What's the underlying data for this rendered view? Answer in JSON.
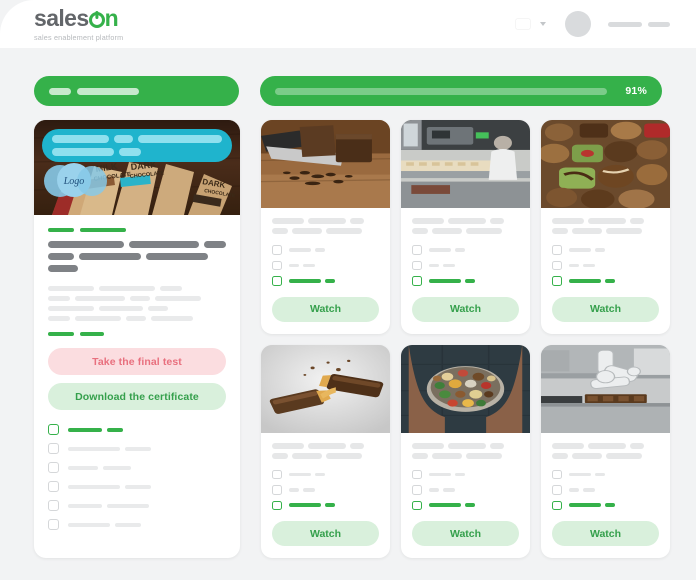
{
  "brand": {
    "name_part1": "sales",
    "name_part2": "n",
    "tagline": "sales enablement platform",
    "accent_green": "#35b14a",
    "logo_grey": "#63666a"
  },
  "topbar": {
    "language_flag": "poland-flag",
    "language_chevron": "chevron-down-icon",
    "avatar": "user-avatar",
    "user_name_placeholder": ""
  },
  "progress": {
    "course_bar": {
      "segments": [
        22,
        62
      ],
      "label": ""
    },
    "module_bar": {
      "percent_label": "91%",
      "percent_value": 91
    }
  },
  "lesson_panel": {
    "hero_image": "chocolate-bars-packaging-photo",
    "hero_banner_rows": [
      [
        58,
        20,
        86
      ],
      [
        62,
        22
      ]
    ],
    "title_dashes": [
      26,
      46
    ],
    "title_rows": [
      [
        76,
        70,
        22
      ],
      [
        26,
        62,
        62
      ],
      [
        30
      ]
    ],
    "body_rows": [
      [
        46,
        56,
        22
      ],
      [
        22,
        50,
        20,
        62
      ],
      [
        46,
        44,
        20
      ],
      [
        22,
        46,
        20,
        50
      ]
    ],
    "footer_dashes": [
      26,
      24
    ],
    "buttons": {
      "final_test": "Take the final test",
      "download_certificate": "Download the certificate"
    },
    "checklist": [
      {
        "active": true,
        "lines": [
          34,
          16
        ]
      },
      {
        "active": false,
        "lines": [
          52,
          26
        ]
      },
      {
        "active": false,
        "lines": [
          30,
          28
        ]
      },
      {
        "active": false,
        "lines": [
          52,
          26
        ]
      },
      {
        "active": false,
        "lines": [
          34,
          42
        ]
      },
      {
        "active": false,
        "lines": [
          42,
          26
        ]
      }
    ]
  },
  "cards": [
    {
      "image": "chopped-dark-chocolate-with-knife-photo",
      "text_rows": [
        [
          32,
          38,
          14
        ],
        [
          16,
          30,
          36
        ]
      ],
      "checklist": [
        {
          "active": false,
          "lines": [
            22,
            10
          ]
        },
        {
          "active": false,
          "lines": [
            10,
            12
          ]
        },
        {
          "active": true,
          "lines": [
            32,
            10
          ]
        }
      ],
      "watch_label": "Watch"
    },
    {
      "image": "chocolate-factory-production-line-photo",
      "text_rows": [
        [
          32,
          38,
          14
        ],
        [
          16,
          30,
          36
        ]
      ],
      "checklist": [
        {
          "active": false,
          "lines": [
            22,
            10
          ]
        },
        {
          "active": false,
          "lines": [
            10,
            12
          ]
        },
        {
          "active": true,
          "lines": [
            32,
            10
          ]
        }
      ],
      "watch_label": "Watch"
    },
    {
      "image": "assorted-chocolate-pralines-photo",
      "text_rows": [
        [
          32,
          38,
          14
        ],
        [
          16,
          30,
          36
        ]
      ],
      "checklist": [
        {
          "active": false,
          "lines": [
            22,
            10
          ]
        },
        {
          "active": false,
          "lines": [
            10,
            12
          ]
        },
        {
          "active": true,
          "lines": [
            32,
            10
          ]
        }
      ],
      "watch_label": "Watch"
    },
    {
      "image": "chocolate-bar-caramel-stretch-photo",
      "text_rows": [
        [
          32,
          38,
          14
        ],
        [
          16,
          30,
          36
        ]
      ],
      "checklist": [
        {
          "active": false,
          "lines": [
            22,
            10
          ]
        },
        {
          "active": false,
          "lines": [
            10,
            12
          ]
        },
        {
          "active": true,
          "lines": [
            32,
            10
          ]
        }
      ],
      "watch_label": "Watch"
    },
    {
      "image": "hands-holding-bowl-of-colorful-candy-photo",
      "text_rows": [
        [
          32,
          38,
          14
        ],
        [
          16,
          30,
          36
        ]
      ],
      "checklist": [
        {
          "active": false,
          "lines": [
            22,
            10
          ]
        },
        {
          "active": false,
          "lines": [
            10,
            12
          ]
        },
        {
          "active": true,
          "lines": [
            32,
            10
          ]
        }
      ],
      "watch_label": "Watch"
    },
    {
      "image": "robotic-arm-factory-photo",
      "text_rows": [
        [
          32,
          38,
          14
        ],
        [
          16,
          30,
          36
        ]
      ],
      "checklist": [
        {
          "active": false,
          "lines": [
            22,
            10
          ]
        },
        {
          "active": false,
          "lines": [
            10,
            12
          ]
        },
        {
          "active": true,
          "lines": [
            32,
            10
          ]
        }
      ],
      "watch_label": "Watch"
    }
  ]
}
